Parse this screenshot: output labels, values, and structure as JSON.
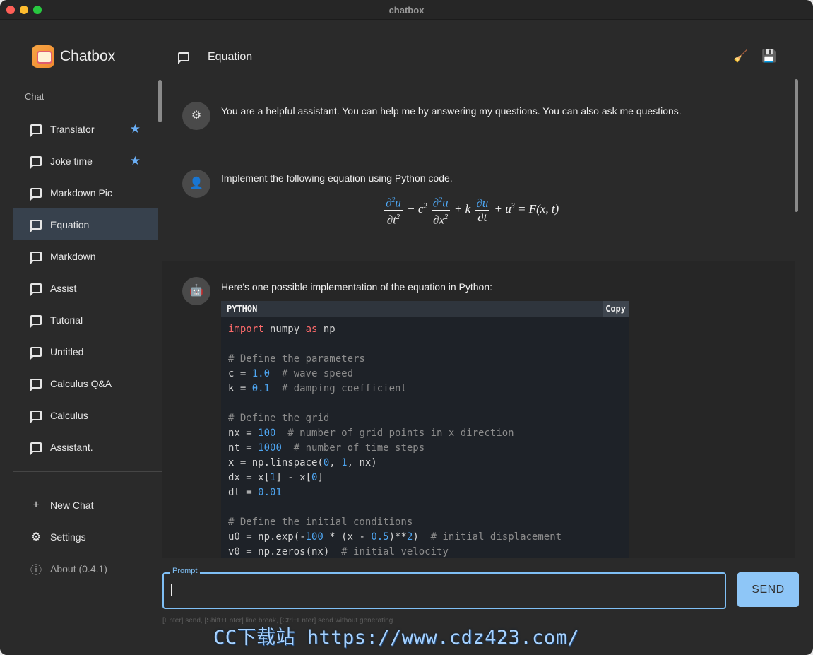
{
  "window": {
    "title": "chatbox"
  },
  "brand": {
    "name": "Chatbox"
  },
  "sidebar": {
    "section_label": "Chat",
    "chats": [
      {
        "label": "Translator",
        "starred": true
      },
      {
        "label": "Joke time",
        "starred": true
      },
      {
        "label": "Markdown Pic",
        "starred": false
      },
      {
        "label": "Equation",
        "starred": false,
        "active": true
      },
      {
        "label": "Markdown",
        "starred": false
      },
      {
        "label": "Assist",
        "starred": false
      },
      {
        "label": "Tutorial",
        "starred": false
      },
      {
        "label": "Untitled",
        "starred": false
      },
      {
        "label": "Calculus Q&A",
        "starred": false
      },
      {
        "label": "Calculus",
        "starred": false
      },
      {
        "label": "Assistant.",
        "starred": false
      }
    ],
    "bottom": {
      "new_chat": "New Chat",
      "settings": "Settings",
      "about": "About (0.4.1)"
    }
  },
  "header": {
    "title": "Equation"
  },
  "messages": {
    "system": "You are a helpful assistant. You can help me by answering my questions. You can also ask me questions.",
    "user": "Implement the following equation using Python code.",
    "assistant": "Here's one possible implementation of the equation in Python:",
    "code": {
      "language": "PYTHON",
      "copy_label": "Copy"
    }
  },
  "input": {
    "label": "Prompt",
    "hint": "[Enter] send, [Shift+Enter] line break, [Ctrl+Enter] send without generating",
    "send_label": "SEND"
  },
  "watermark": "CC下载站 https://www.cdz423.com/",
  "colors": {
    "accent": "#7fbff5",
    "send": "#8ec6f7",
    "active_item": "#37414d",
    "star": "#6aaef5"
  }
}
